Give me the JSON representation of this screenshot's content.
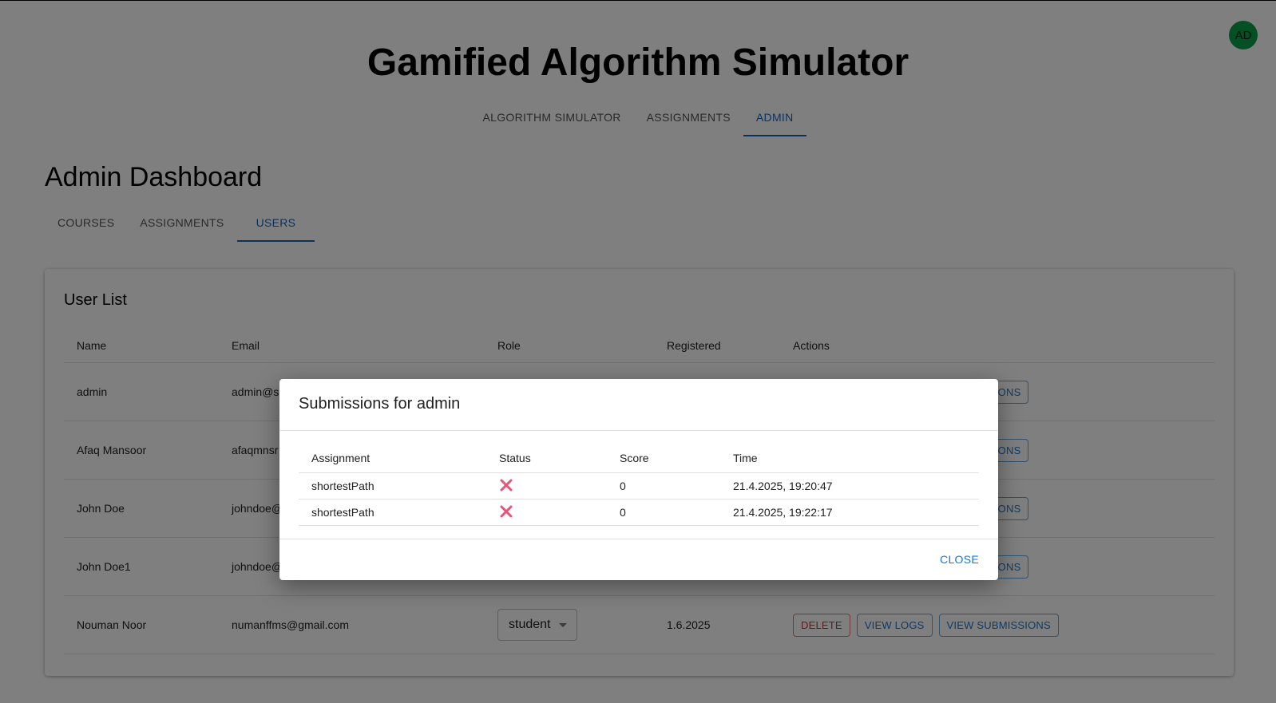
{
  "header": {
    "avatar_initials": "AD",
    "app_title": "Gamified Algorithm Simulator",
    "tabs": [
      {
        "label": "ALGORITHM SIMULATOR",
        "active": false
      },
      {
        "label": "ASSIGNMENTS",
        "active": false
      },
      {
        "label": "ADMIN",
        "active": true
      }
    ]
  },
  "dashboard": {
    "title": "Admin Dashboard",
    "tabs": [
      {
        "label": "COURSES",
        "active": false
      },
      {
        "label": "ASSIGNMENTS",
        "active": false
      },
      {
        "label": "USERS",
        "active": true
      }
    ]
  },
  "user_list": {
    "title": "User List",
    "columns": [
      "Name",
      "Email",
      "Role",
      "Registered",
      "Actions"
    ],
    "rows": [
      {
        "name": "admin",
        "email": "admin@si",
        "role": "",
        "registered": ""
      },
      {
        "name": "Afaq Mansoor",
        "email": "afaqmnsr",
        "role": "",
        "registered": ""
      },
      {
        "name": "John Doe",
        "email": "johndoe@",
        "role": "",
        "registered": ""
      },
      {
        "name": "John Doe1",
        "email": "johndoe@",
        "role": "",
        "registered": ""
      },
      {
        "name": "Nouman Noor",
        "email": "numanffms@gmail.com",
        "role": "student",
        "registered": "1.6.2025"
      }
    ],
    "actions": {
      "delete_label": "DELETE",
      "view_logs_label": "VIEW LOGS",
      "view_submissions_label": "VIEW SUBMISSIONS",
      "partial_submissions_label": "SIONS"
    }
  },
  "dialog": {
    "title": "Submissions for admin",
    "columns": [
      "Assignment",
      "Status",
      "Score",
      "Time"
    ],
    "rows": [
      {
        "assignment": "shortestPath",
        "status_icon": "x-icon",
        "score": "0",
        "time": "21.4.2025, 19:20:47"
      },
      {
        "assignment": "shortestPath",
        "status_icon": "x-icon",
        "score": "0",
        "time": "21.4.2025, 19:22:17"
      }
    ],
    "close_label": "CLOSE"
  },
  "colors": {
    "accent": "#1565c0",
    "avatar_bg": "#0a9e4a",
    "delete": "#d32f2f",
    "fail_icon": "#e8537a"
  }
}
